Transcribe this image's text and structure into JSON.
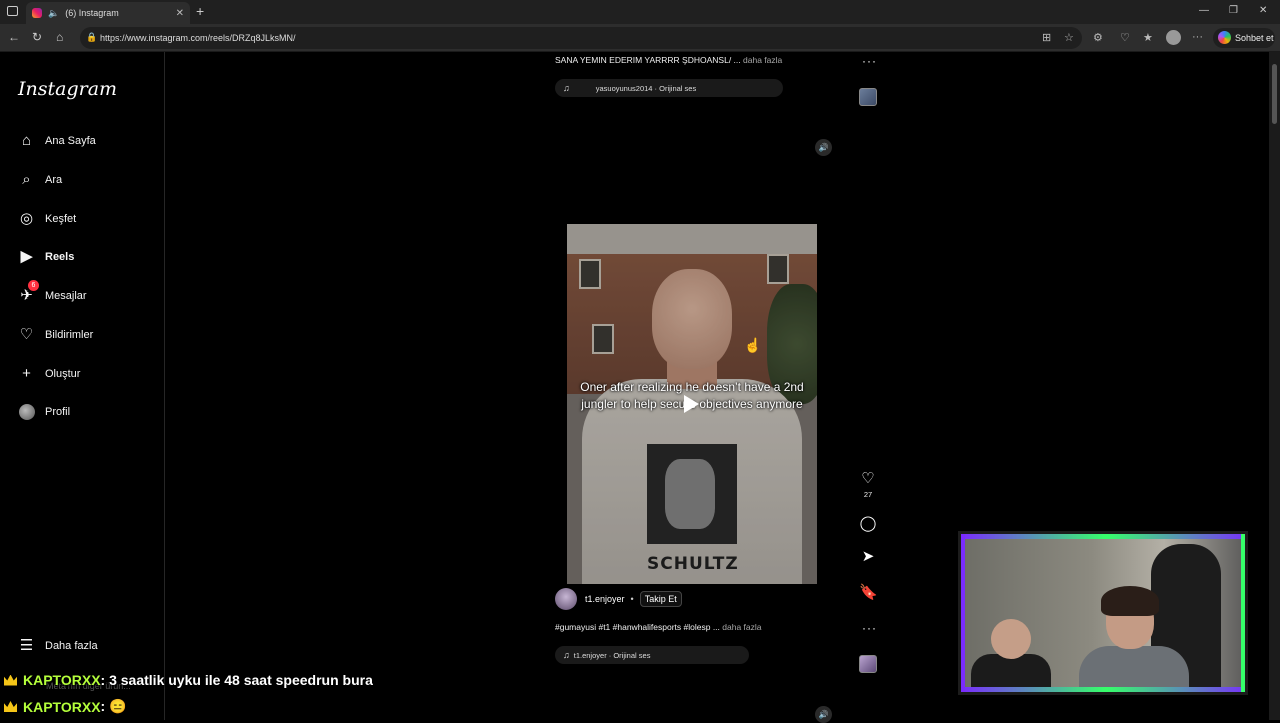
{
  "browser": {
    "tab_title": "(6) Instagram",
    "new_tab_icon": "+",
    "url": "https://www.instagram.com/reels/DRZq8JLksMN/",
    "chat_button_label": "Sohbet et"
  },
  "sidebar": {
    "logo": "Instagram",
    "items": [
      {
        "label": "Ana Sayfa",
        "icon": "home-icon"
      },
      {
        "label": "Ara",
        "icon": "search-icon"
      },
      {
        "label": "Keşfet",
        "icon": "compass-icon"
      },
      {
        "label": "Reels",
        "icon": "reels-icon"
      },
      {
        "label": "Mesajlar",
        "icon": "messenger-icon",
        "badge": "6"
      },
      {
        "label": "Bildirimler",
        "icon": "heart-icon"
      },
      {
        "label": "Oluştur",
        "icon": "plus-icon"
      },
      {
        "label": "Profil",
        "icon": "profile-avatar"
      }
    ],
    "more_label": "Daha fazla"
  },
  "reel_top": {
    "caption": "SANA YEMIN EDERIM YARRRR ŞDHOANSL/ ...",
    "more": "daha fazla",
    "audio": "yasuoyunus2014 · Orijinal ses"
  },
  "reel_main": {
    "video_caption": "Oner after realizing he doesn’t have a 2nd jungler to help secure objectives anymore",
    "shirt_text": "SCHULTZ",
    "like_count": "27",
    "author": "t1.enjoyer",
    "separator": "•",
    "follow_label": "Takip Et",
    "caption": "#gumayusi #t1 #hanwhalifesports #lolesp ...",
    "more": "daha fazla",
    "audio": "t1.enjoyer · Orijinal ses"
  },
  "stream_chat": [
    {
      "user": "KAPTORXX",
      "message": ": 3 saatlik uyku ile 48 saat speedrun bura"
    },
    {
      "user": "KAPTORXX",
      "message": ": 😑"
    }
  ],
  "ghost_text": "Meta'nın diğer ürün...",
  "colors": {
    "accent_badge": "#ff3040",
    "chat_user": "#b5ff3b",
    "webcam_glow_green": "#36ff6a",
    "webcam_glow_purple": "#7a2bff"
  }
}
